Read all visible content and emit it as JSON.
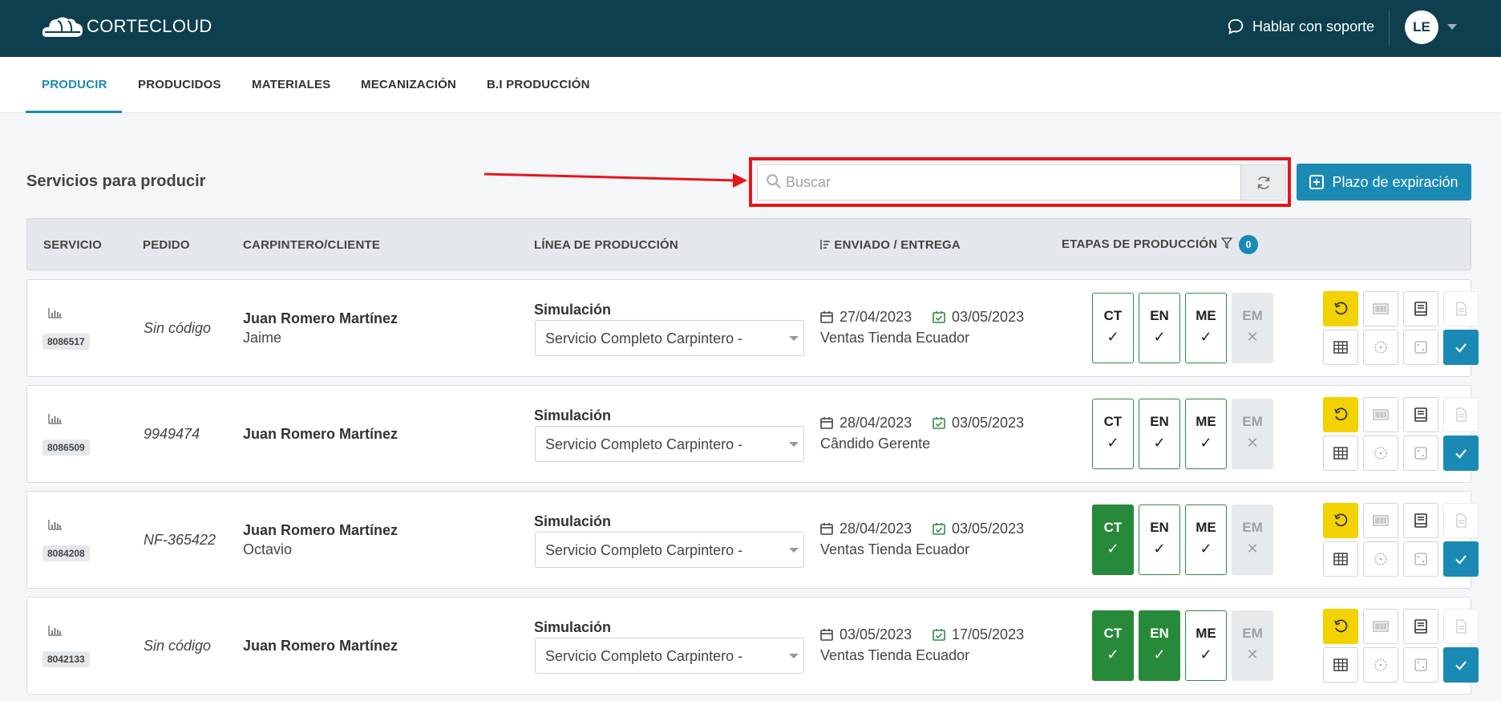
{
  "app": {
    "logo_text": "CORTECLOUD",
    "support_label": "Hablar con soporte",
    "user_initials": "LE"
  },
  "tabs": [
    {
      "label": "PRODUCIR",
      "active": true
    },
    {
      "label": "PRODUCIDOS",
      "active": false
    },
    {
      "label": "MATERIALES",
      "active": false
    },
    {
      "label": "MECANIZACIÓN",
      "active": false
    },
    {
      "label": "B.I PRODUCCIÓN",
      "active": false
    }
  ],
  "main": {
    "section_title": "Servicios para producir",
    "search_placeholder": "Buscar",
    "search_value": "",
    "expire_button": "Plazo de expiración",
    "highlight_color": "#e8141b",
    "accent_color": "#1a8ab5"
  },
  "table": {
    "headers": {
      "servicio": "SERVICIO",
      "pedido": "PEDIDO",
      "cliente": "CARPINTERO/CLIENTE",
      "linea": "LÍNEA DE PRODUCCIÓN",
      "enviado": "ENVIADO / ENTREGA",
      "etapas": "ETAPAS DE PRODUCCIÓN",
      "etapas_count": "0"
    },
    "rows": [
      {
        "id": "8086517",
        "pedido": "Sin código",
        "cliente": "Juan Romero Martínez",
        "subcliente": "Jaime",
        "linea_label": "Simulación",
        "linea_value": "Servicio Completo Carpintero -",
        "enviado": "27/04/2023",
        "entrega": "03/05/2023",
        "store": "Ventas Tienda Ecuador",
        "stages": [
          {
            "code": "CT",
            "status": "check"
          },
          {
            "code": "EN",
            "status": "check"
          },
          {
            "code": "ME",
            "status": "check"
          },
          {
            "code": "EM",
            "status": "off"
          }
        ]
      },
      {
        "id": "8086509",
        "pedido": "9949474",
        "cliente": "Juan Romero Martínez",
        "subcliente": "",
        "linea_label": "Simulación",
        "linea_value": "Servicio Completo Carpintero -",
        "enviado": "28/04/2023",
        "entrega": "03/05/2023",
        "store": "Cândido Gerente",
        "stages": [
          {
            "code": "CT",
            "status": "check"
          },
          {
            "code": "EN",
            "status": "check"
          },
          {
            "code": "ME",
            "status": "check"
          },
          {
            "code": "EM",
            "status": "off"
          }
        ]
      },
      {
        "id": "8084208",
        "pedido": "NF-365422",
        "cliente": "Juan Romero Martínez",
        "subcliente": "Octavio",
        "linea_label": "Simulación",
        "linea_value": "Servicio Completo Carpintero -",
        "enviado": "28/04/2023",
        "entrega": "03/05/2023",
        "store": "Ventas Tienda Ecuador",
        "stages": [
          {
            "code": "CT",
            "status": "done"
          },
          {
            "code": "EN",
            "status": "check"
          },
          {
            "code": "ME",
            "status": "check"
          },
          {
            "code": "EM",
            "status": "off"
          }
        ]
      },
      {
        "id": "8042133",
        "pedido": "Sin código",
        "cliente": "Juan Romero Martínez",
        "subcliente": "",
        "linea_label": "Simulación",
        "linea_value": "Servicio Completo Carpintero -",
        "enviado": "03/05/2023",
        "entrega": "17/05/2023",
        "store": "Ventas Tienda Ecuador",
        "stages": [
          {
            "code": "CT",
            "status": "done"
          },
          {
            "code": "EN",
            "status": "done"
          },
          {
            "code": "ME",
            "status": "check"
          },
          {
            "code": "EM",
            "status": "off"
          }
        ]
      }
    ],
    "stage_marks": {
      "check": "✓",
      "done": "✓",
      "off": "✕"
    },
    "colors": {
      "stage_done": "#278a3a",
      "stage_border": "#2e8b3e",
      "undo_yellow": "#f2d200"
    },
    "row_action_icons": [
      "undo-icon",
      "barcode-icon",
      "book-icon",
      "document-icon",
      "table-icon",
      "clock-icon",
      "dice-icon",
      "check-icon"
    ]
  }
}
